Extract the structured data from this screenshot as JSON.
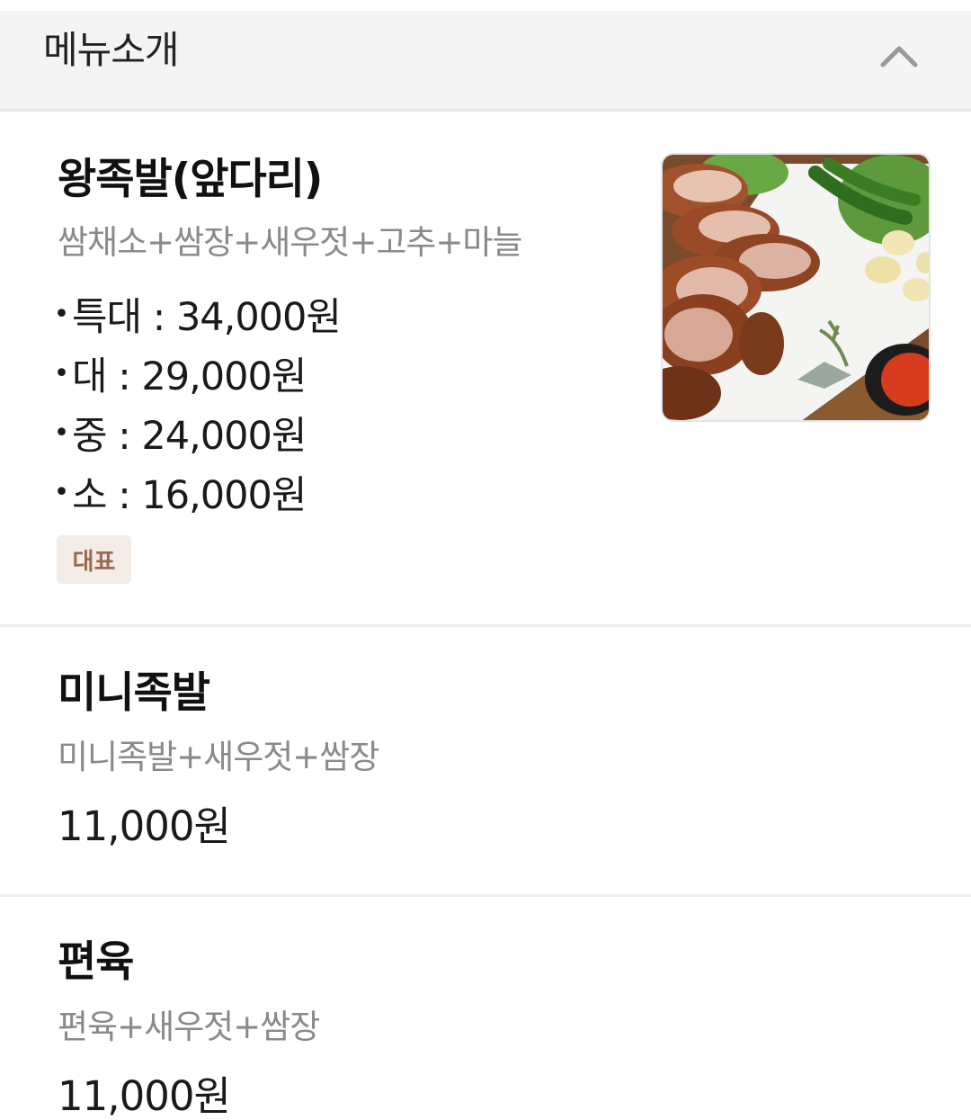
{
  "section": {
    "title": "메뉴소개",
    "collapse_icon": "chevron-up-icon"
  },
  "menu_items": [
    {
      "name": "왕족발(앞다리)",
      "description": "쌈채소+쌈장+새우젓+고추+마늘",
      "prices": [
        {
          "label": "특대 : 34,000원"
        },
        {
          "label": "대 : 29,000원"
        },
        {
          "label": "중 : 24,000원"
        },
        {
          "label": "소 : 16,000원"
        }
      ],
      "badge": "대표",
      "has_photo": true
    },
    {
      "name": "미니족발",
      "description": "미니족발+새우젓+쌈장",
      "price": "11,000원"
    },
    {
      "name": "편육",
      "description": "편육+새우젓+쌈장",
      "price": "11,000원"
    }
  ],
  "colors": {
    "header_bg": "#f4f4f4",
    "badge_bg": "#f3ece7",
    "badge_text": "#9b6a4e",
    "desc_text": "#8a8a8a"
  }
}
